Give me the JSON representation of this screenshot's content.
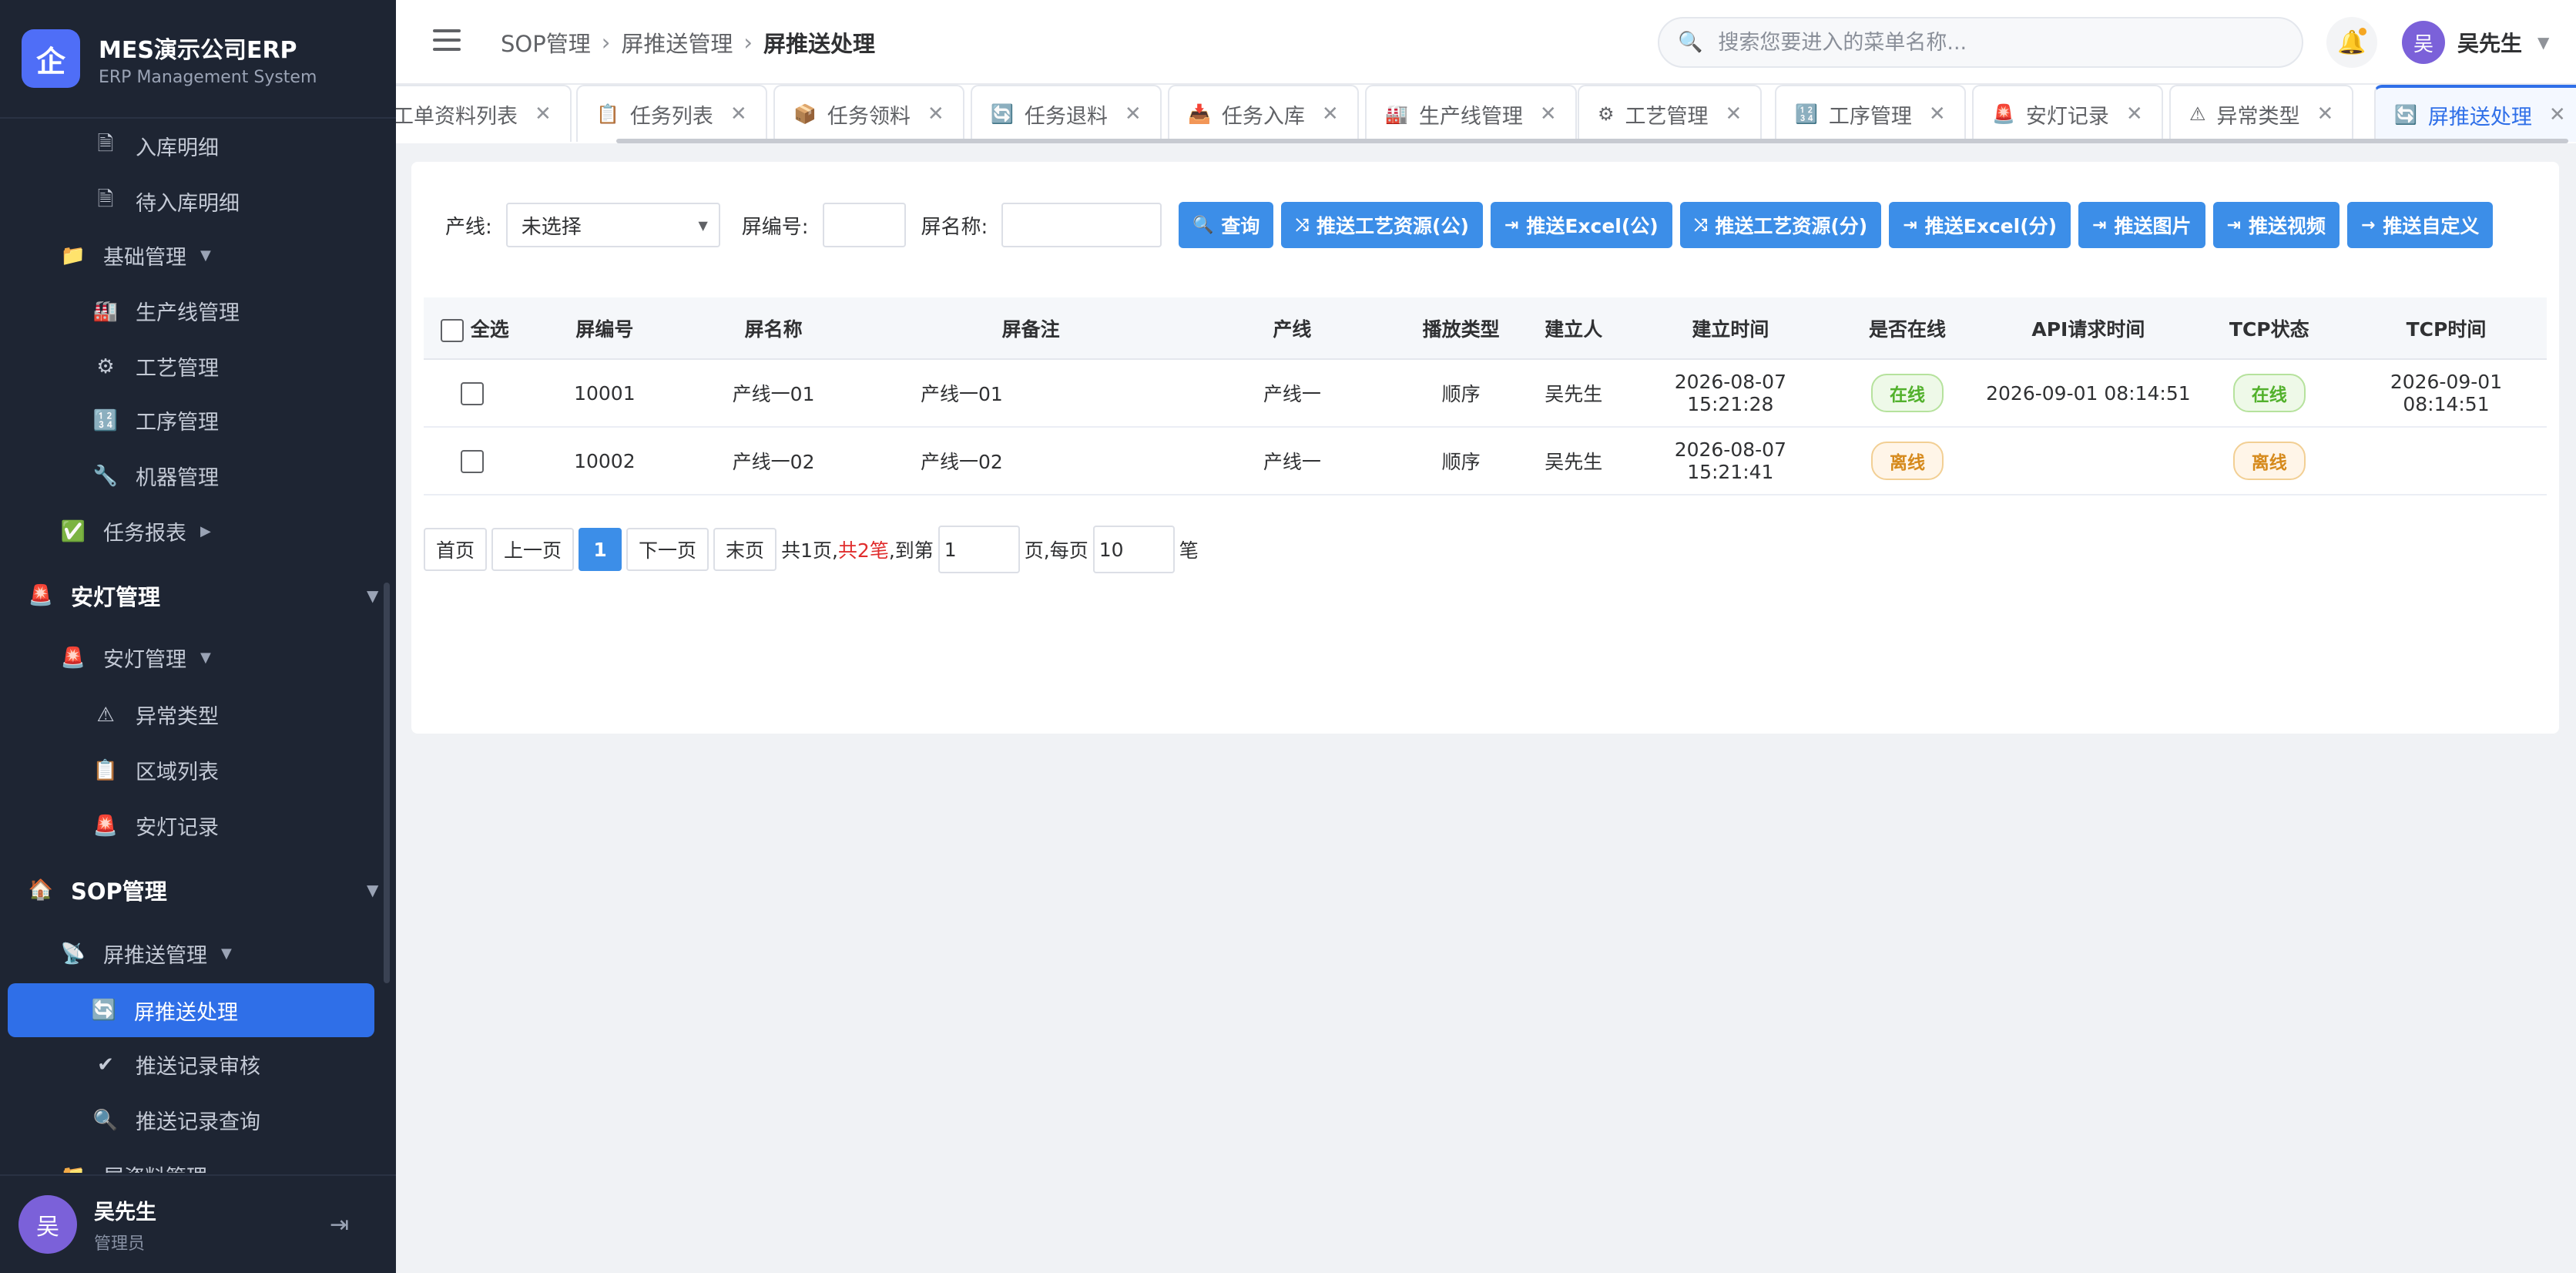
{
  "brand": {
    "name": "MES演示公司ERP",
    "subtitle": "ERP Management System",
    "logo_char": "企"
  },
  "menu": {
    "items": [
      {
        "label": "入库明细",
        "icon": "document-icon"
      },
      {
        "label": "待入库明细",
        "icon": "document-icon"
      },
      {
        "label": "基础管理",
        "icon": "folder-icon"
      },
      {
        "label": "生产线管理",
        "icon": "factory-icon"
      },
      {
        "label": "工艺管理",
        "icon": "gear-icon"
      },
      {
        "label": "工序管理",
        "icon": "numbers-icon"
      },
      {
        "label": "机器管理",
        "icon": "wrench-icon"
      },
      {
        "label": "任务报表",
        "icon": "check-icon"
      },
      {
        "label": "安灯管理",
        "icon": "alarm-icon"
      },
      {
        "label": "安灯管理",
        "icon": "alarm-icon"
      },
      {
        "label": "异常类型",
        "icon": "warning-icon"
      },
      {
        "label": "区域列表",
        "icon": "clipboard-icon"
      },
      {
        "label": "安灯记录",
        "icon": "alarm-icon"
      },
      {
        "label": "SOP管理",
        "icon": "house-icon"
      },
      {
        "label": "屏推送管理",
        "icon": "satellite-icon"
      },
      {
        "label": "屏推送处理",
        "icon": "refresh-icon"
      },
      {
        "label": "推送记录审核",
        "icon": "checkmark-icon"
      },
      {
        "label": "推送记录查询",
        "icon": "magnifier-icon"
      },
      {
        "label": "屏资料管理",
        "icon": "folder-icon"
      }
    ]
  },
  "footer_user": {
    "avatar": "吴",
    "name": "吴先生",
    "role": "管理员"
  },
  "header": {
    "breadcrumb": [
      "SOP管理",
      "屏推送管理",
      "屏推送处理"
    ],
    "search_placeholder": "搜索您要进入的菜单名称...",
    "user_avatar": "吴",
    "user_name": "吴先生"
  },
  "tabs": [
    {
      "label": "工单资料列表",
      "icon": ""
    },
    {
      "label": "任务列表",
      "icon": "📋"
    },
    {
      "label": "任务领料",
      "icon": "📦"
    },
    {
      "label": "任务退料",
      "icon": "🔄"
    },
    {
      "label": "任务入库",
      "icon": "📥"
    },
    {
      "label": "生产线管理",
      "icon": "🏭"
    },
    {
      "label": "工艺管理",
      "icon": "⚙"
    },
    {
      "label": "工序管理",
      "icon": "🔢"
    },
    {
      "label": "安灯记录",
      "icon": "🚨"
    },
    {
      "label": "异常类型",
      "icon": "⚠"
    },
    {
      "label": "屏推送处理",
      "icon": "🔄"
    }
  ],
  "filters": {
    "line_label": "产线:",
    "line_value": "未选择",
    "screen_no_label": "屏编号:",
    "screen_name_label": "屏名称:"
  },
  "buttons": [
    {
      "label": "查询",
      "icon": "search-icon"
    },
    {
      "label": "推送工艺资源(公)",
      "icon": "push-icon"
    },
    {
      "label": "推送Excel(公)",
      "icon": "export-icon"
    },
    {
      "label": "推送工艺资源(分)",
      "icon": "push-icon"
    },
    {
      "label": "推送Excel(分)",
      "icon": "export-icon"
    },
    {
      "label": "推送图片",
      "icon": "export-icon"
    },
    {
      "label": "推送视频",
      "icon": "export-icon"
    },
    {
      "label": "推送自定义",
      "icon": "arrow-icon"
    }
  ],
  "table": {
    "select_all": "全选",
    "columns": [
      "屏编号",
      "屏名称",
      "屏备注",
      "产线",
      "播放类型",
      "建立人",
      "建立时间",
      "是否在线",
      "API请求时间",
      "TCP状态",
      "TCP时间"
    ],
    "rows": [
      {
        "screen_no": "10001",
        "screen_name": "产线一01",
        "remark": "产线一01",
        "line": "产线一",
        "play_type": "顺序",
        "creator": "吴先生",
        "created": "2026-08-07 15:21:28",
        "online": "在线",
        "api_time": "2026-09-01 08:14:51",
        "tcp_status": "在线",
        "tcp_time": "2026-09-01 08:14:51"
      },
      {
        "screen_no": "10002",
        "screen_name": "产线一02",
        "remark": "产线一02",
        "line": "产线一",
        "play_type": "顺序",
        "creator": "吴先生",
        "created": "2026-08-07 15:21:41",
        "online": "离线",
        "api_time": "",
        "tcp_status": "离线",
        "tcp_time": ""
      }
    ]
  },
  "pager": {
    "first": "首页",
    "prev": "上一页",
    "current": "1",
    "next": "下一页",
    "last": "末页",
    "total_pages": "共1页,",
    "total_records": "共2笔",
    "goto_prefix": ",到第",
    "goto_value": "1",
    "page_suffix": "页,每页",
    "size_value": "10",
    "size_suffix": "笔"
  }
}
